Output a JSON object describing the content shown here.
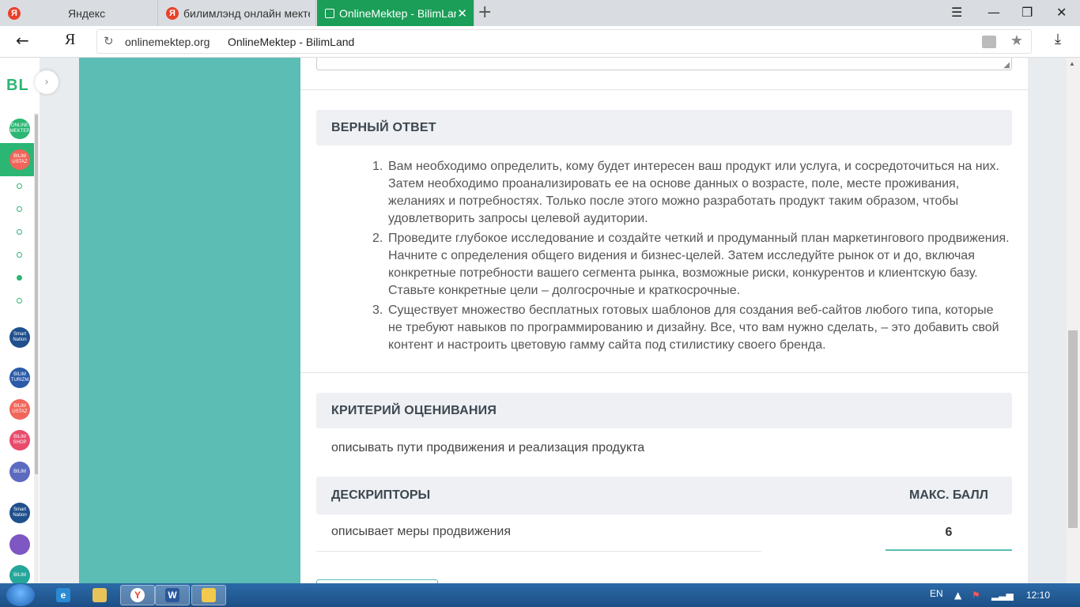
{
  "browser": {
    "tabs": [
      {
        "label": "Яндекс",
        "favicon": "Я"
      },
      {
        "label": "билимлэнд онлайн мектеп",
        "favicon": "Я"
      },
      {
        "label": "OnlineMektep - BilimLand",
        "favicon": ""
      }
    ],
    "new_tab": "+",
    "ya_button": "Я",
    "url_domain": "onlinemektep.org",
    "url_title": "OnlineMektep - BilimLand"
  },
  "sidebar": {
    "logo": "BL",
    "services": [
      {
        "name": "ONLINE MEKTEP",
        "color": "#2bb673"
      },
      {
        "name": "BILIM USTAZ",
        "color": "#f2655a"
      },
      {
        "name": "Smart Nation",
        "color": "#1f4f8c"
      },
      {
        "name": "BILIM TURIZM",
        "color": "#2a5aa8"
      },
      {
        "name": "BILIM USTAZ",
        "color": "#f2655a"
      },
      {
        "name": "BILIM SHOP",
        "color": "#e94b6b"
      },
      {
        "name": "BILIM",
        "color": "#5c6bc0"
      },
      {
        "name": "Smart Nation",
        "color": "#1f4f8c"
      },
      {
        "name": "",
        "color": "#7e57c2"
      },
      {
        "name": "BILIM",
        "color": "#26a69a"
      }
    ]
  },
  "content": {
    "correct_answer_title": "ВЕРНЫЙ ОТВЕТ",
    "answers": [
      {
        "num": "1.",
        "text": "Вам необходимо определить, кому будет интересен ваш продукт или услуга, и сосредоточиться на них. Затем необходимо проанализировать ее на основе данных о возрасте, поле, месте проживания, желаниях и потребностях. Только после этого можно разработать продукт таким образом, чтобы удовлетворить запросы целевой аудитории."
      },
      {
        "num": "2.",
        "text": "Проведите глубокое исследование и создайте четкий и продуманный план маркетингового продвижения. Начните с определения общего видения и бизнес-целей. Затем исследуйте рынок от и до, включая конкретные потребности вашего сегмента рынка, возможные риски, конкурентов и клиентскую базу. Ставьте конкретные цели – долгосрочные и краткосрочные."
      },
      {
        "num": "3.",
        "text": "Существует множество бесплатных готовых шаблонов для создания веб-сайтов любого типа, которые не требуют навыков по программированию и дизайну. Все, что вам нужно сделать, – это добавить свой контент и настроить цветовую гамму сайта под стилистику своего бренда."
      }
    ],
    "criteria_title": "КРИТЕРИЙ ОЦЕНИВАНИЯ",
    "criteria_text": "описывать пути продвижения и реализация продукта",
    "descriptors_title": "ДЕСКРИПТОРЫ",
    "max_score_title": "МАКС. БАЛЛ",
    "descriptor_row": "описывает меры продвижения",
    "descriptor_score": "6"
  },
  "taskbar": {
    "lang": "EN",
    "time": "12:10"
  }
}
